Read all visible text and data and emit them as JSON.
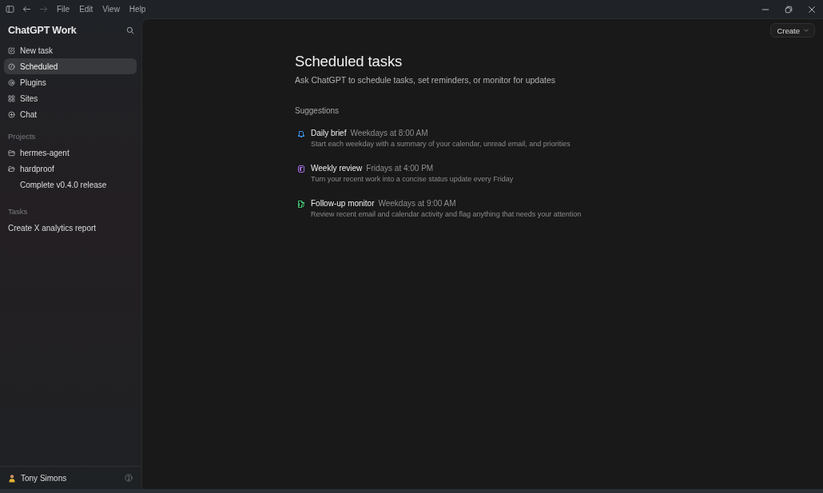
{
  "window": {
    "nav_buttons": [
      {
        "kind": "back",
        "disabled": false
      },
      {
        "kind": "forward",
        "disabled": true
      }
    ],
    "menu": [
      "File",
      "Edit",
      "View",
      "Help"
    ]
  },
  "sidebar": {
    "title": "ChatGPT Work",
    "items": [
      {
        "kind": "new-task",
        "label": "New task",
        "selected": false
      },
      {
        "kind": "scheduled",
        "label": "Scheduled",
        "selected": true
      },
      {
        "kind": "plugins",
        "label": "Plugins",
        "selected": false
      },
      {
        "kind": "sites",
        "label": "Sites",
        "selected": false
      },
      {
        "kind": "chat",
        "label": "Chat",
        "selected": false
      }
    ],
    "projects": {
      "heading": "Projects",
      "items": [
        {
          "label": "hermes-agent",
          "expanded": false
        },
        {
          "label": "hardproof",
          "expanded": true,
          "children": [
            {
              "label": "Complete v0.4.0 release"
            }
          ]
        }
      ]
    },
    "tasks": {
      "heading": "Tasks",
      "items": [
        {
          "label": "Create X analytics report"
        }
      ]
    },
    "user": {
      "name": "Tony Simons"
    }
  },
  "main": {
    "create_button": "Create",
    "title": "Scheduled tasks",
    "subtitle": "Ask ChatGPT to schedule tasks, set reminders, or monitor for updates",
    "suggestions": {
      "heading": "Suggestions",
      "items": [
        {
          "kind": "bell",
          "color": "#3b8ee8",
          "title": "Daily brief",
          "schedule": "Weekdays at 8:00 AM",
          "description": "Start each weekday with a summary of your calendar, unread email, and priorities"
        },
        {
          "kind": "note",
          "color": "#a36ee0",
          "title": "Weekly review",
          "schedule": "Fridays at 4:00 PM",
          "description": "Turn your recent work into a concise status update every Friday"
        },
        {
          "kind": "doc-search",
          "color": "#3fb96b",
          "title": "Follow-up monitor",
          "schedule": "Weekdays at 9:00 AM",
          "description": "Review recent email and calendar activity and flag anything that needs your attention"
        }
      ]
    }
  }
}
